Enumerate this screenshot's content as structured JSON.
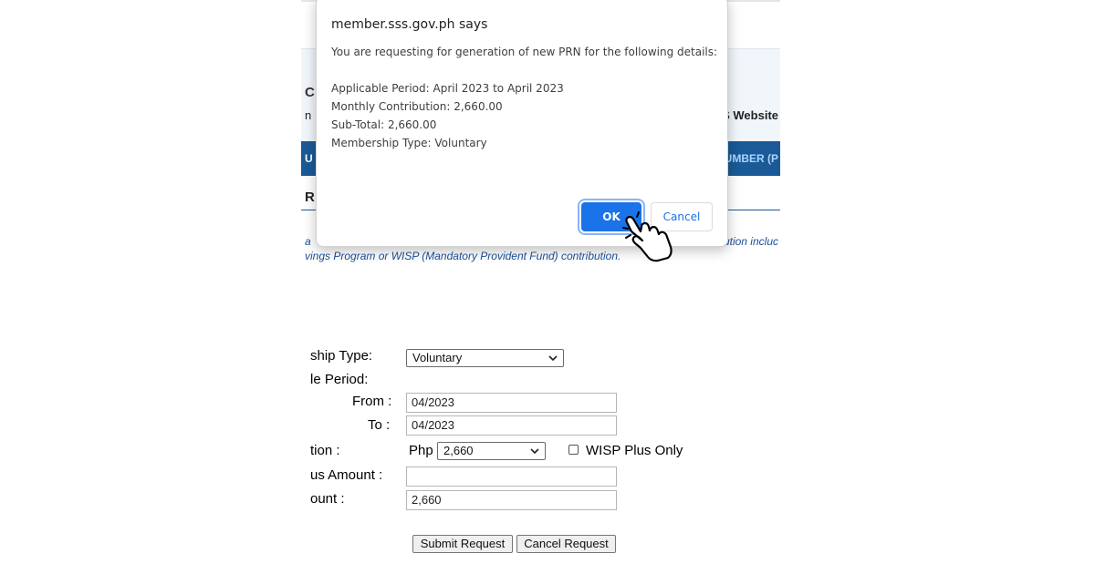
{
  "background_page": {
    "header_title_fragment": "C",
    "header_sub_fragment": "n",
    "header_link_fragment": "S Website",
    "nav_left_fragment": "U",
    "nav_right_fragment": "UMBER (P",
    "section_heading_fragment": "R",
    "note_line1_left": "a",
    "note_line1_right": "ution  incluc",
    "note_line2": "vings Program or WISP (Mandatory Provident Fund) contribution."
  },
  "form": {
    "membership_type_label": "ship Type:",
    "membership_type_value": "Voluntary",
    "applicable_period_label": "le Period:",
    "from_label": "From :",
    "from_value": "04/2023",
    "to_label": "To :",
    "to_value": "04/2023",
    "contribution_label": "tion :",
    "currency": "Php",
    "contribution_value": "2,660",
    "wisp_plus_label": "WISP Plus Only",
    "wisp_plus_checked": false,
    "plus_amount_label": "us Amount :",
    "plus_amount_value": "",
    "total_amount_label": "ount :",
    "total_amount_value": "2,660",
    "submit_label": "Submit Request",
    "cancel_label": "Cancel Request"
  },
  "dialog": {
    "title": "member.sss.gov.ph says",
    "message": "You are requesting for generation of new PRN for the following details:",
    "details": [
      "Applicable Period: April 2023 to April 2023",
      "Monthly Contribution: 2,660.00",
      "Sub-Total: 2,660.00",
      "Membership Type: Voluntary"
    ],
    "ok_label": "OK",
    "cancel_label": "Cancel"
  },
  "icons": {
    "cursor": "hand-pointer-icon",
    "dropdown": "chevron-down-icon"
  },
  "colors": {
    "nav_bar": "#1a5a96",
    "link_blue": "#1a4f9a",
    "dialog_primary": "#1a73e8"
  }
}
